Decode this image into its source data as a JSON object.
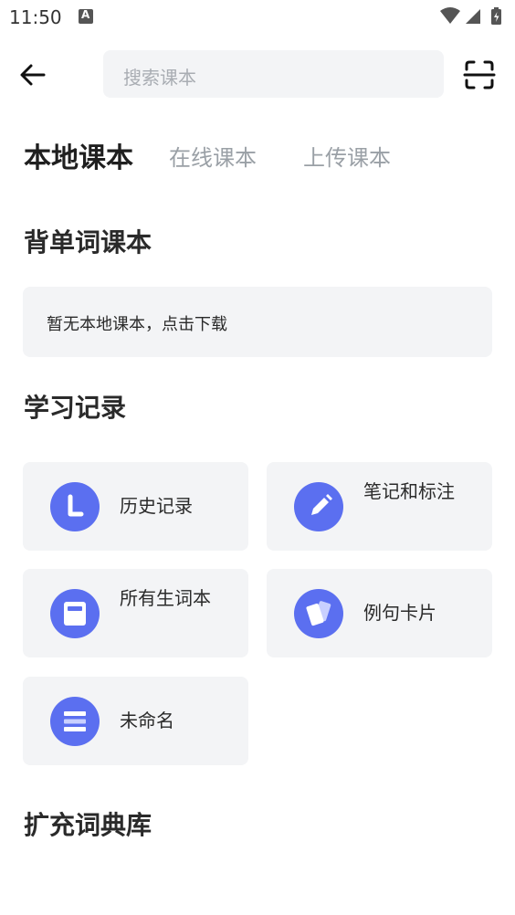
{
  "status_bar": {
    "time": "11:50"
  },
  "search": {
    "placeholder": "搜索课本"
  },
  "tabs": [
    {
      "label": "本地课本",
      "active": true
    },
    {
      "label": "在线课本",
      "active": false
    },
    {
      "label": "上传课本",
      "active": false
    }
  ],
  "sections": {
    "word_books": {
      "title": "背单词课本",
      "empty_text": "暂无本地课本，点击下载"
    },
    "study_records": {
      "title": "学习记录",
      "items": [
        {
          "label": "历史记录",
          "icon": "history-icon"
        },
        {
          "label": "笔记和标注",
          "icon": "pencil-icon"
        },
        {
          "label": "所有生词本",
          "icon": "notebook-icon"
        },
        {
          "label": "例句卡片",
          "icon": "cards-icon"
        },
        {
          "label": "未命名",
          "icon": "list-icon"
        }
      ]
    },
    "dictionaries": {
      "title": "扩充词典库"
    }
  },
  "colors": {
    "accent": "#5b6ff0",
    "card_bg": "#f3f4f6",
    "inactive_tab": "#9aa0a6"
  }
}
